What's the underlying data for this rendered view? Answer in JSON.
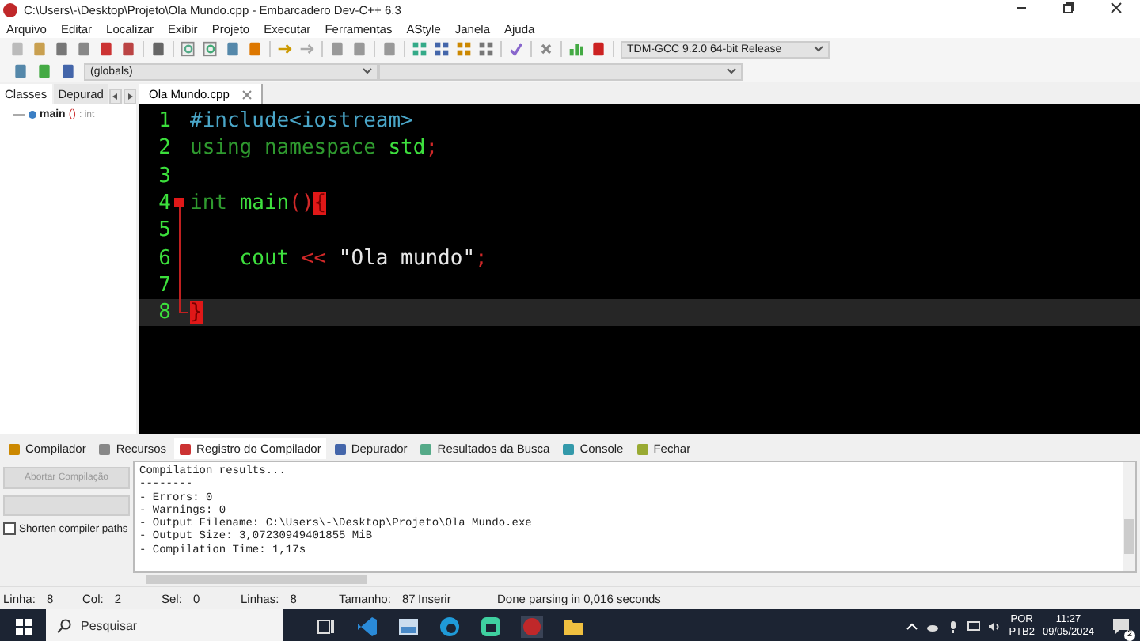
{
  "window": {
    "title": "C:\\Users\\-\\Desktop\\Projeto\\Ola Mundo.cpp - Embarcadero Dev-C++ 6.3"
  },
  "menu": [
    "Arquivo",
    "Editar",
    "Localizar",
    "Exibir",
    "Projeto",
    "Executar",
    "Ferramentas",
    "AStyle",
    "Janela",
    "Ajuda"
  ],
  "compiler_select": {
    "value": "TDM-GCC 9.2.0 64-bit Release"
  },
  "scope_select": {
    "value": "(globals)"
  },
  "left_tabs": [
    {
      "label": "Classes",
      "selected": true
    },
    {
      "label": "Depurad",
      "selected": false
    }
  ],
  "class_tree": [
    {
      "name": "main",
      "signature": "()",
      "type": ": int"
    }
  ],
  "editor_tabs": [
    {
      "label": "Ola Mundo.cpp",
      "selected": true
    }
  ],
  "code": [
    {
      "number": "1",
      "current": false,
      "fold_start": false,
      "in_fold": false,
      "indented": false,
      "tokens": [
        {
          "text": "#include<iostream>",
          "kind": "preprocessor"
        }
      ]
    },
    {
      "number": "2",
      "current": false,
      "fold_start": false,
      "in_fold": false,
      "indented": false,
      "tokens": [
        {
          "text": "using namespace ",
          "kind": "keyword"
        },
        {
          "text": "std",
          "kind": "identifier"
        },
        {
          "text": ";",
          "kind": "symbol"
        }
      ]
    },
    {
      "number": "3",
      "current": false,
      "fold_start": false,
      "in_fold": false,
      "indented": false
    },
    {
      "number": "4",
      "current": false,
      "fold_start": true,
      "in_fold": false,
      "indented": false,
      "tokens": [
        {
          "text": "int ",
          "kind": "keyword"
        },
        {
          "text": "main",
          "kind": "identifier"
        },
        {
          "text": "()",
          "kind": "symbol"
        },
        {
          "text": "{",
          "kind": "brace-match"
        }
      ]
    },
    {
      "number": "5",
      "current": false,
      "fold_start": false,
      "in_fold": true,
      "indented": false
    },
    {
      "number": "6",
      "current": false,
      "fold_start": false,
      "in_fold": true,
      "indented": true,
      "tokens": [
        {
          "text": "cout",
          "kind": "identifier"
        },
        {
          "text": " << ",
          "kind": "symbol"
        },
        {
          "text": "\"Ola mundo\"",
          "kind": "string"
        },
        {
          "text": ";",
          "kind": "symbol"
        }
      ]
    },
    {
      "number": "7",
      "current": false,
      "fold_start": false,
      "in_fold": true,
      "indented": false
    },
    {
      "number": "8",
      "current": true,
      "fold_start": false,
      "in_fold": true,
      "indented": false,
      "tokens": [
        {
          "text": "}",
          "kind": "brace-match"
        }
      ]
    }
  ],
  "bottom_tabs": [
    {
      "label": "Compilador",
      "selected": false
    },
    {
      "label": "Recursos",
      "selected": false
    },
    {
      "label": "Registro do Compilador",
      "selected": true
    },
    {
      "label": "Depurador",
      "selected": false
    },
    {
      "label": "Resultados da Busca",
      "selected": false
    },
    {
      "label": "Console",
      "selected": false
    },
    {
      "label": "Fechar",
      "selected": false
    }
  ],
  "compile_panel": {
    "abort_button": {
      "label": "Abortar Compilação",
      "disabled": true
    },
    "shorten_paths": {
      "label": "Shorten compiler paths",
      "checked": false
    }
  },
  "log": [
    "Compilation results...",
    "--------",
    "- Errors: 0",
    "- Warnings: 0",
    "- Output Filename: C:\\Users\\-\\Desktop\\Projeto\\Ola Mundo.exe",
    "- Output Size: 3,07230949401855 MiB",
    "- Compilation Time: 1,17s"
  ],
  "status_bar": [
    {
      "label": "Linha:",
      "value": "8"
    },
    {
      "label": "Col:",
      "value": "2"
    },
    {
      "label": "Sel:",
      "value": "0"
    },
    {
      "label": "Linhas:",
      "value": "8"
    },
    {
      "label": "Tamanho:",
      "value": "87"
    }
  ],
  "status_mode": "Inserir",
  "status_message": "Done parsing in 0,016 seconds",
  "taskbar": {
    "search_placeholder": "Pesquisar",
    "language": "POR",
    "layout": "PTB2",
    "time": "11:27",
    "date": "09/05/2024",
    "notifications": "2"
  }
}
